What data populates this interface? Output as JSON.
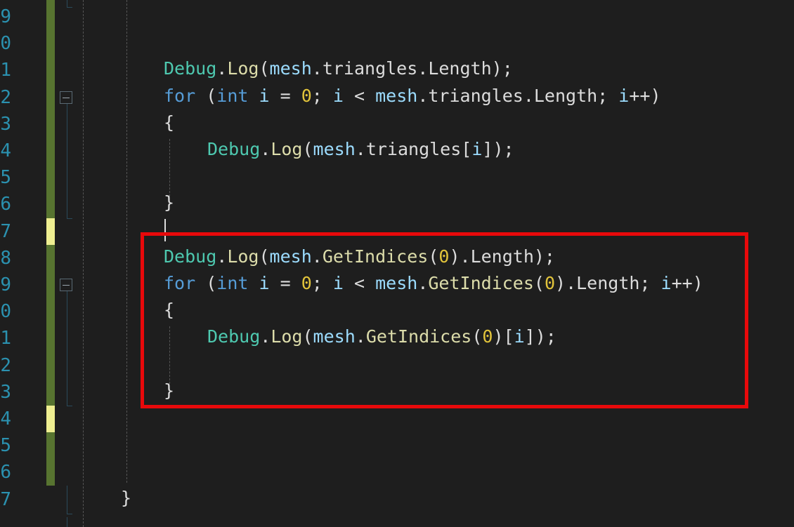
{
  "editor": {
    "line_numbers": [
      "9",
      "0",
      "1",
      "2",
      "3",
      "4",
      "5",
      "6",
      "7",
      "8",
      "9",
      "0",
      "1",
      "2",
      "3",
      "4",
      "5",
      "6",
      "7"
    ],
    "lines": [
      {
        "tokens": [
          {
            "t": "Debug",
            "c": "class"
          },
          {
            "t": ".",
            "c": "punct"
          },
          {
            "t": "Log",
            "c": "method"
          },
          {
            "t": "(",
            "c": "punct"
          },
          {
            "t": "mesh",
            "c": "var"
          },
          {
            "t": ".triangles.Length);",
            "c": "punct"
          }
        ]
      },
      {
        "tokens": [
          {
            "t": "for",
            "c": "keyword"
          },
          {
            "t": " (",
            "c": "punct"
          },
          {
            "t": "int",
            "c": "keyword"
          },
          {
            "t": " ",
            "c": "punct"
          },
          {
            "t": "i",
            "c": "var"
          },
          {
            "t": " = ",
            "c": "punct"
          },
          {
            "t": "0",
            "c": "number"
          },
          {
            "t": "; ",
            "c": "punct"
          },
          {
            "t": "i",
            "c": "var"
          },
          {
            "t": " < ",
            "c": "punct"
          },
          {
            "t": "mesh",
            "c": "var"
          },
          {
            "t": ".triangles.Length; ",
            "c": "punct"
          },
          {
            "t": "i",
            "c": "var"
          },
          {
            "t": "++)",
            "c": "punct"
          }
        ]
      },
      {
        "tokens": [
          {
            "t": "{",
            "c": "punct"
          }
        ]
      },
      {
        "tokens": [
          {
            "t": "Debug",
            "c": "class"
          },
          {
            "t": ".",
            "c": "punct"
          },
          {
            "t": "Log",
            "c": "method"
          },
          {
            "t": "(",
            "c": "punct"
          },
          {
            "t": "mesh",
            "c": "var"
          },
          {
            "t": ".triangles[",
            "c": "punct"
          },
          {
            "t": "i",
            "c": "var"
          },
          {
            "t": "]);",
            "c": "punct"
          }
        ]
      },
      {
        "tokens": [
          {
            "t": "}",
            "c": "punct"
          }
        ]
      },
      {
        "tokens": [
          {
            "t": "Debug",
            "c": "class"
          },
          {
            "t": ".",
            "c": "punct"
          },
          {
            "t": "Log",
            "c": "method"
          },
          {
            "t": "(",
            "c": "punct"
          },
          {
            "t": "mesh",
            "c": "var"
          },
          {
            "t": ".",
            "c": "punct"
          },
          {
            "t": "GetIndices",
            "c": "method"
          },
          {
            "t": "(",
            "c": "punct"
          },
          {
            "t": "0",
            "c": "number"
          },
          {
            "t": ").Length);",
            "c": "punct"
          }
        ]
      },
      {
        "tokens": [
          {
            "t": "for",
            "c": "keyword"
          },
          {
            "t": " (",
            "c": "punct"
          },
          {
            "t": "int",
            "c": "keyword"
          },
          {
            "t": " ",
            "c": "punct"
          },
          {
            "t": "i",
            "c": "var"
          },
          {
            "t": " = ",
            "c": "punct"
          },
          {
            "t": "0",
            "c": "number"
          },
          {
            "t": "; ",
            "c": "punct"
          },
          {
            "t": "i",
            "c": "var"
          },
          {
            "t": " < ",
            "c": "punct"
          },
          {
            "t": "mesh",
            "c": "var"
          },
          {
            "t": ".",
            "c": "punct"
          },
          {
            "t": "GetIndices",
            "c": "method"
          },
          {
            "t": "(",
            "c": "punct"
          },
          {
            "t": "0",
            "c": "number"
          },
          {
            "t": ").Length; ",
            "c": "punct"
          },
          {
            "t": "i",
            "c": "var"
          },
          {
            "t": "++)",
            "c": "punct"
          }
        ]
      },
      {
        "tokens": [
          {
            "t": "{",
            "c": "punct"
          }
        ]
      },
      {
        "tokens": [
          {
            "t": "Debug",
            "c": "class"
          },
          {
            "t": ".",
            "c": "punct"
          },
          {
            "t": "Log",
            "c": "method"
          },
          {
            "t": "(",
            "c": "punct"
          },
          {
            "t": "mesh",
            "c": "var"
          },
          {
            "t": ".",
            "c": "punct"
          },
          {
            "t": "GetIndices",
            "c": "method"
          },
          {
            "t": "(",
            "c": "punct"
          },
          {
            "t": "0",
            "c": "number"
          },
          {
            "t": ")[",
            "c": "punct"
          },
          {
            "t": "i",
            "c": "var"
          },
          {
            "t": "]);",
            "c": "punct"
          }
        ]
      },
      {
        "tokens": [
          {
            "t": "}",
            "c": "punct"
          }
        ]
      },
      {
        "tokens": [
          {
            "t": "}",
            "c": "punct"
          }
        ]
      }
    ],
    "colors": {
      "background": "#1e1e1e",
      "line_number": "#2b91af",
      "class": "#4ec9b0",
      "method": "#dcdcaa",
      "variable": "#9cdcfe",
      "keyword": "#569cd6",
      "number": "#e2c43b",
      "punctuation": "#dcdcdc",
      "saved_change": "#577430",
      "unsaved_change": "#efef91",
      "highlight_box": "#e8090b"
    }
  }
}
